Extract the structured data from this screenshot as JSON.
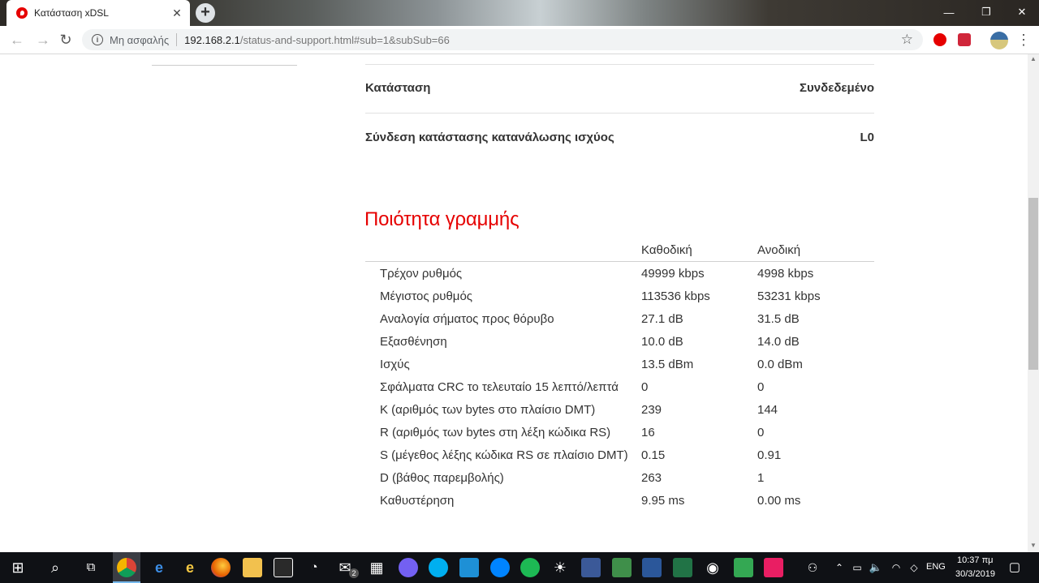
{
  "browser": {
    "tab_title": "Κατάσταση xDSL",
    "security_label": "Μη ασφαλής",
    "url_host": "192.168.2.1",
    "url_path": "/status-and-support.html#sub=1&subSub=66"
  },
  "status": [
    {
      "label": "Κατάσταση",
      "value": "Συνδεδεμένο"
    },
    {
      "label": "Σύνδεση κατάστασης κατανάλωσης ισχύος",
      "value": "L0"
    }
  ],
  "line_quality": {
    "title": "Ποιότητα γραμμής",
    "columns": [
      "",
      "Καθοδική",
      "Ανοδική"
    ],
    "rows": [
      [
        "Τρέχον ρυθμός",
        "49999 kbps",
        "4998 kbps"
      ],
      [
        "Μέγιστος ρυθμός",
        "113536 kbps",
        "53231 kbps"
      ],
      [
        "Αναλογία σήματος προς θόρυβο",
        "27.1 dB",
        "31.5 dB"
      ],
      [
        "Εξασθένηση",
        "10.0 dB",
        "14.0 dB"
      ],
      [
        "Ισχύς",
        "13.5 dBm",
        "0.0 dBm"
      ],
      [
        "Σφάλματα CRC το τελευταίο 15 λεπτό/λεπτά",
        "0",
        "0"
      ],
      [
        "K (αριθμός των bytes στο πλαίσιο DMT)",
        "239",
        "144"
      ],
      [
        "R (αριθμός των bytes στη λέξη κώδικα RS)",
        "16",
        "0"
      ],
      [
        "S (μέγεθος λέξης κώδικα RS σε πλαίσιο DMT)",
        "0.15",
        "0.91"
      ],
      [
        "D (βάθος παρεμβολής)",
        "263",
        "1"
      ],
      [
        "Καθυστέρηση",
        "9.95 ms",
        "0.00 ms"
      ]
    ]
  },
  "taskbar": {
    "language": "ENG",
    "time": "10:37 πμ",
    "date": "30/3/2019",
    "mail_badge": "2"
  },
  "colors": {
    "accent": "#e60000",
    "taskbar": "#0f1115"
  }
}
